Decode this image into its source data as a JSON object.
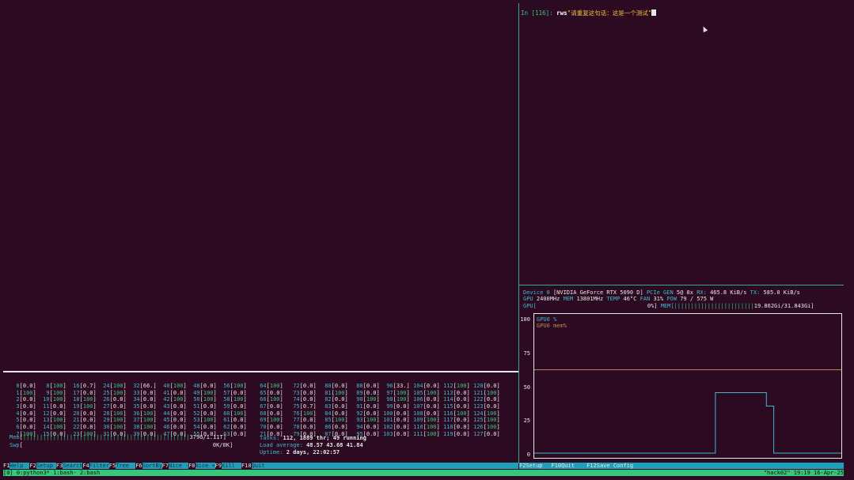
{
  "ipython": {
    "prompt_label": "In [116]: ",
    "command": "rws",
    "argument": "\"请重复这句话：这是一个测试\""
  },
  "htop": {
    "cpu_columns": [
      [
        [
          "0",
          "0.0"
        ],
        [
          "1",
          "100"
        ],
        [
          "2",
          "0.0"
        ],
        [
          "3",
          "0.0"
        ],
        [
          "4",
          "0.0"
        ],
        [
          "5",
          "0.0"
        ],
        [
          "6",
          "0.0"
        ],
        [
          "7",
          "100"
        ]
      ],
      [
        [
          "8",
          "100"
        ],
        [
          "9",
          "100"
        ],
        [
          "10",
          "100"
        ],
        [
          "11",
          "0.0"
        ],
        [
          "12",
          "0.0"
        ],
        [
          "13",
          "100"
        ],
        [
          "14",
          "100"
        ],
        [
          "15",
          "0.0"
        ]
      ],
      [
        [
          "16",
          "0.7"
        ],
        [
          "17",
          "0.0"
        ],
        [
          "18",
          "100"
        ],
        [
          "19",
          "100"
        ],
        [
          "20",
          "0.0"
        ],
        [
          "21",
          "0.0"
        ],
        [
          "22",
          "0.0"
        ],
        [
          "23",
          "100"
        ]
      ],
      [
        [
          "24",
          "100"
        ],
        [
          "25",
          "100"
        ],
        [
          "26",
          "0.0"
        ],
        [
          "27",
          "0.0"
        ],
        [
          "28",
          "100"
        ],
        [
          "29",
          "100"
        ],
        [
          "30",
          "100"
        ],
        [
          "31",
          "0.0"
        ]
      ],
      [
        [
          "32",
          "66."
        ],
        [
          "33",
          "0.0"
        ],
        [
          "34",
          "0.0"
        ],
        [
          "35",
          "0.0"
        ],
        [
          "36",
          "100"
        ],
        [
          "37",
          "100"
        ],
        [
          "38",
          "100"
        ],
        [
          "39",
          "0.0"
        ]
      ],
      [
        [
          "40",
          "100"
        ],
        [
          "41",
          "0.0"
        ],
        [
          "42",
          "100"
        ],
        [
          "43",
          "0.0"
        ],
        [
          "44",
          "0.0"
        ],
        [
          "45",
          "0.0"
        ],
        [
          "46",
          "0.0"
        ],
        [
          "47",
          "0.0"
        ]
      ],
      [
        [
          "48",
          "0.0"
        ],
        [
          "49",
          "100"
        ],
        [
          "50",
          "100"
        ],
        [
          "51",
          "0.0"
        ],
        [
          "52",
          "0.0"
        ],
        [
          "53",
          "100"
        ],
        [
          "54",
          "0.0"
        ],
        [
          "55",
          "0.0"
        ]
      ],
      [
        [
          "56",
          "100"
        ],
        [
          "57",
          "0.0"
        ],
        [
          "58",
          "100"
        ],
        [
          "59",
          "0.0"
        ],
        [
          "60",
          "100"
        ],
        [
          "61",
          "0.0"
        ],
        [
          "62",
          "0.0"
        ],
        [
          "63",
          "0.0"
        ]
      ],
      [
        [
          "64",
          "100"
        ],
        [
          "65",
          "0.0"
        ],
        [
          "66",
          "100"
        ],
        [
          "67",
          "0.0"
        ],
        [
          "68",
          "0.0"
        ],
        [
          "69",
          "100"
        ],
        [
          "70",
          "0.0"
        ],
        [
          "71",
          "0.0"
        ]
      ],
      [
        [
          "72",
          "0.0"
        ],
        [
          "73",
          "0.0"
        ],
        [
          "74",
          "0.0"
        ],
        [
          "75",
          "0.7"
        ],
        [
          "76",
          "100"
        ],
        [
          "77",
          "0.0"
        ],
        [
          "78",
          "0.0"
        ],
        [
          "79",
          "0.0"
        ]
      ],
      [
        [
          "80",
          "0.0"
        ],
        [
          "81",
          "100"
        ],
        [
          "82",
          "0.0"
        ],
        [
          "83",
          "0.0"
        ],
        [
          "84",
          "0.0"
        ],
        [
          "85",
          "100"
        ],
        [
          "86",
          "0.0"
        ],
        [
          "87",
          "0.0"
        ]
      ],
      [
        [
          "88",
          "0.0"
        ],
        [
          "89",
          "0.0"
        ],
        [
          "90",
          "100"
        ],
        [
          "91",
          "0.0"
        ],
        [
          "92",
          "0.0"
        ],
        [
          "93",
          "100"
        ],
        [
          "94",
          "0.0"
        ],
        [
          "95",
          "0.0"
        ]
      ],
      [
        [
          "96",
          "33."
        ],
        [
          "97",
          "100"
        ],
        [
          "98",
          "100"
        ],
        [
          "99",
          "0.0"
        ],
        [
          "100",
          "0.0"
        ],
        [
          "101",
          "0.0"
        ],
        [
          "102",
          "0.0"
        ],
        [
          "103",
          "0.0"
        ]
      ],
      [
        [
          "104",
          "0.0"
        ],
        [
          "105",
          "100"
        ],
        [
          "106",
          "0.0"
        ],
        [
          "107",
          "0.0"
        ],
        [
          "108",
          "0.0"
        ],
        [
          "109",
          "100"
        ],
        [
          "110",
          "100"
        ],
        [
          "111",
          "100"
        ]
      ],
      [
        [
          "112",
          "100"
        ],
        [
          "113",
          "0.0"
        ],
        [
          "114",
          "0.0"
        ],
        [
          "115",
          "0.0"
        ],
        [
          "116",
          "100"
        ],
        [
          "117",
          "0.0"
        ],
        [
          "118",
          "0.0"
        ],
        [
          "119",
          "0.0"
        ]
      ],
      [
        [
          "120",
          "0.0"
        ],
        [
          "121",
          "100"
        ],
        [
          "122",
          "0.0"
        ],
        [
          "123",
          "0.0"
        ],
        [
          "124",
          "100"
        ],
        [
          "125",
          "100"
        ],
        [
          "126",
          "100"
        ],
        [
          "127",
          "0.0"
        ]
      ]
    ],
    "mem_label": "Mem",
    "mem_value": "379G/1.11T",
    "swp_label": "Swp",
    "swp_value": "0K/0K",
    "tasks_label": "Tasks: ",
    "tasks_value": "112, 1889 thr; 49 running",
    "load_label": "Load average: ",
    "load_value": "48.57 43.68 41.84",
    "uptime_label": "Uptime: ",
    "uptime_value": "2 days, 22:02:57",
    "function_keys": [
      {
        "key": "F1",
        "label": "Help"
      },
      {
        "key": "F2",
        "label": "Setup"
      },
      {
        "key": "F3",
        "label": "Search"
      },
      {
        "key": "F4",
        "label": "Filter"
      },
      {
        "key": "F5",
        "label": "Tree"
      },
      {
        "key": "F6",
        "label": "SortBy"
      },
      {
        "key": "F7",
        "label": "Nice -"
      },
      {
        "key": "F8",
        "label": "Nice +"
      },
      {
        "key": "F9",
        "label": "Kill"
      },
      {
        "key": "F10",
        "label": "Quit"
      }
    ]
  },
  "nvtop": {
    "line1": {
      "device": "Device 0",
      "name": "[NVIDIA GeForce RTX 5090 D]",
      "pcie": "PCIe GEN",
      "pcie_val": "5@ 8x",
      "rx": "RX:",
      "rx_val": "465.8 KiB/s",
      "tx": "TX:",
      "tx_val": "585.0 KiB/s"
    },
    "line2": {
      "gpu": "GPU",
      "gpu_val": "2400MHz",
      "mem": "MEM",
      "mem_val": "13801MHz",
      "temp": "TEMP",
      "temp_val": "46°C",
      "fan": "FAN",
      "fan_val": "31%",
      "pow": "POW",
      "pow_val": "79 / 575 W"
    },
    "line3": {
      "gpu": "GPU[",
      "gpu_pct": "0%]",
      "mem": "MEM[",
      "mem_val": "19.862Gi/31.843Gi]"
    },
    "function_keys": [
      {
        "key": "F2",
        "label": "Setup"
      },
      {
        "key": "F10",
        "label": "Quit"
      },
      {
        "key": "F12",
        "label": "Save Config"
      }
    ]
  },
  "chart_data": {
    "type": "line",
    "yticks": [
      "100",
      "75",
      "50",
      "25",
      "0"
    ],
    "ylim": [
      0,
      100
    ],
    "series": [
      {
        "name": "GPU0 %",
        "color": "#3fb8c8",
        "points": [
          [
            0,
            0
          ],
          [
            0.59,
            0
          ],
          [
            0.59,
            45
          ],
          [
            0.756,
            45
          ],
          [
            0.756,
            35
          ],
          [
            0.78,
            35
          ],
          [
            0.78,
            0
          ],
          [
            1,
            0
          ]
        ]
      },
      {
        "name": "GPU0 mem%",
        "color": "#c08a50",
        "points": [
          [
            0,
            62
          ],
          [
            1,
            62
          ]
        ]
      }
    ]
  },
  "tmux": {
    "left": "[0] 0:python3* 1:bash- 2:bash",
    "right": "\"hack02\" 19:19 16-Apr-25"
  }
}
